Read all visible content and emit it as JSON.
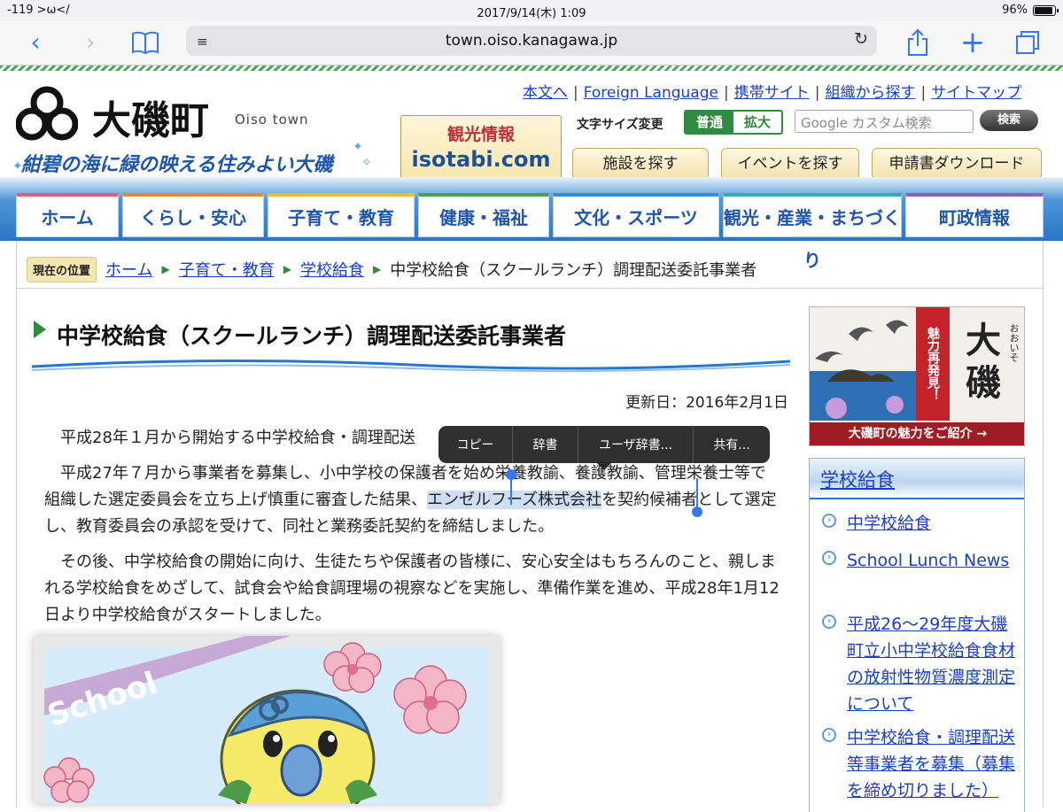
{
  "status_bar": {
    "signal": "-119 >ω</",
    "datetime": "2017/9/14(木) 1:09",
    "battery": "96%"
  },
  "browser": {
    "url": "town.oiso.kanagawa.jp"
  },
  "header": {
    "logo_text": "大磯町",
    "logo_sub": "Oiso town",
    "tagline": "紺碧の海に緑の映える住みよい大磯",
    "top_links": [
      "本文へ",
      "Foreign Language",
      "携帯サイト",
      "組織から探す",
      "サイトマップ"
    ],
    "isotabi_line1": "観光情報",
    "isotabi_line2": "isotabi.com",
    "font_size_label": "文字サイズ変更",
    "font_size_normal": "普通",
    "font_size_large": "拡大",
    "search_placeholder": "Google カスタム検索",
    "search_button": "検索",
    "find_buttons": [
      "施設を探す",
      "イベントを探す",
      "申請書ダウンロード"
    ]
  },
  "nav": [
    "ホーム",
    "くらし・安心",
    "子育て・教育",
    "健康・福祉",
    "文化・スポーツ",
    "観光・産業・まちづくり",
    "町政情報"
  ],
  "breadcrumb": {
    "label": "現在の位置",
    "links": [
      "ホーム",
      "子育て・教育",
      "学校給食"
    ],
    "current": "中学校給食（スクールランチ）調理配送委託事業者"
  },
  "article": {
    "title": "中学校給食（スクールランチ）調理配送委託事業者",
    "updated": "更新日：2016年2月1日",
    "p1": "　平成28年１月から開始する中学校給食・調理配送",
    "p2_a": "　平成27年７月から事業者を募集し、小中学校の保護者を始め栄養教諭、養護教諭、管理栄養士等で組織した選定委員会を立ち上げ慎重に審査した結果、",
    "p2_sel": "エンゼルフーズ株式会社",
    "p2_b": "を契約候補者として選定し、教育委員会の承認を受けて、同社と業務委託契約を締結しました。",
    "p3": "　その後、中学校給食の開始に向け、生徒たちや保護者の皆様に、安心安全はもちろんのこと、親しまれる学校給食をめざして、試食会や給食調理場の視察などを実施し、準備作業を進め、平成28年1月12日より中学校給食がスタートしました。",
    "illustration_text": "School"
  },
  "context_menu": [
    "コピー",
    "辞書",
    "ユーザ辞書...",
    "共有..."
  ],
  "sidebar": {
    "promo_big": "大磯",
    "promo_ruby": "おおいそ",
    "promo_ribbon": "魅力再発見！",
    "promo_caption": "大磯町の魅力をご紹介 →",
    "section_title": "学校給食",
    "items": [
      "中学校給食",
      "School Lunch News",
      "平成26～29年度大磯町立小中学校給食食材の放射性物質濃度測定について",
      "中学校給食・調理配送等事業者を募集（募集を締め切りました）"
    ]
  },
  "colors": {
    "link": "#1a3fbf",
    "accent_green": "#2e8b3f",
    "nav_blue": "#2a75c6",
    "ios_blue": "#3478f6"
  }
}
